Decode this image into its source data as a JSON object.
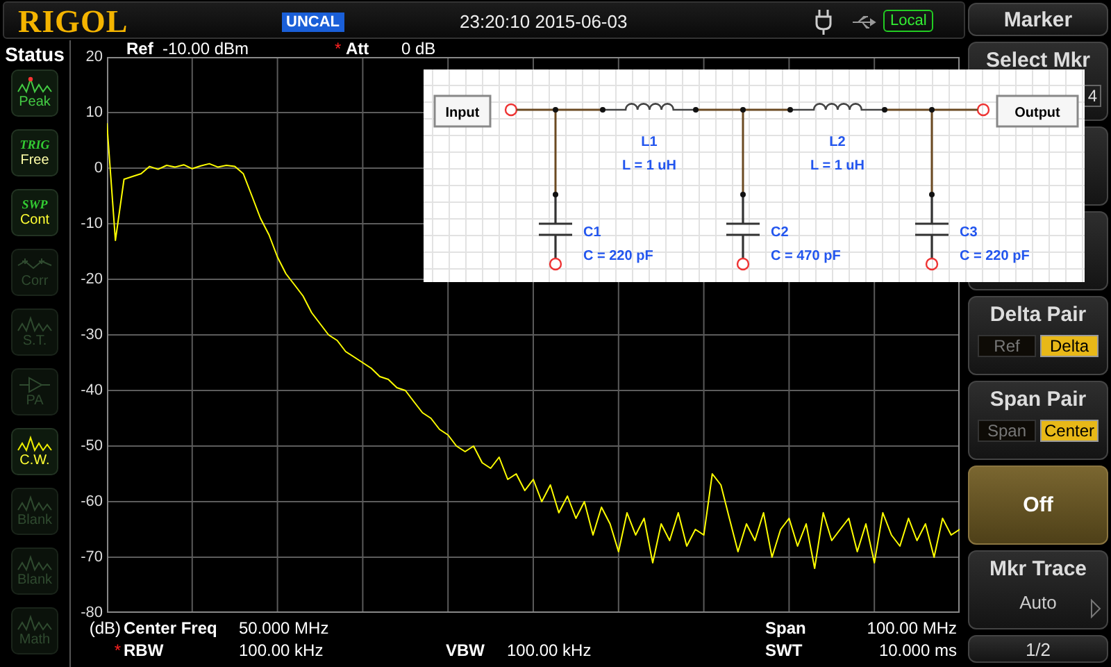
{
  "header": {
    "logo": "RIGOL",
    "mode_badge": "UNCAL",
    "datetime": "23:20:10 2015-06-03",
    "remote_badge": "Local"
  },
  "sidebar": {
    "title": "Status",
    "items": [
      {
        "kind": "peak",
        "caption": "Peak",
        "enabled": true
      },
      {
        "kind": "trig",
        "tag": "TRIG",
        "caption": "Free",
        "enabled": true
      },
      {
        "kind": "swp",
        "tag": "SWP",
        "caption": "Cont",
        "enabled": true
      },
      {
        "kind": "corr",
        "caption": "Corr",
        "enabled": false
      },
      {
        "kind": "st",
        "caption": "S.T.",
        "enabled": false
      },
      {
        "kind": "pa",
        "caption": "PA",
        "enabled": false
      },
      {
        "kind": "cw",
        "caption": "C.W.",
        "enabled": true
      },
      {
        "kind": "blank",
        "caption": "Blank",
        "enabled": false
      },
      {
        "kind": "blank",
        "caption": "Blank",
        "enabled": false
      },
      {
        "kind": "math",
        "caption": "Math",
        "enabled": false
      }
    ]
  },
  "plot": {
    "ref_label": "Ref",
    "ref_value": "-10.00 dBm",
    "att_mark": "*",
    "att_label": "Att",
    "att_value": "0 dB",
    "chart_data": {
      "type": "line",
      "grid": true,
      "ylim": [
        -80,
        20
      ],
      "yticks": [
        20,
        10,
        0,
        -10,
        -20,
        -30,
        -40,
        -50,
        -60,
        -70,
        -80
      ],
      "categories": [
        null,
        null,
        null,
        null,
        null,
        null,
        null,
        null,
        null,
        null,
        null,
        null,
        null,
        null,
        null,
        null,
        null,
        null,
        null,
        null,
        null,
        null,
        null,
        null,
        null,
        null,
        null,
        null,
        null,
        null,
        null,
        null,
        null,
        null,
        null,
        null,
        null,
        null,
        null,
        null,
        null,
        null,
        null,
        null,
        null,
        null,
        null,
        null,
        null,
        null,
        null,
        null,
        null,
        null,
        null,
        null,
        null,
        null,
        null,
        null,
        null,
        null,
        null,
        null,
        null,
        null,
        null,
        null,
        null,
        null,
        null,
        null,
        null,
        null,
        null,
        null,
        null,
        null,
        null,
        null,
        null,
        null,
        null,
        null,
        null,
        null,
        null,
        null,
        null,
        null,
        null,
        null,
        null,
        null,
        null,
        null,
        null,
        null,
        null,
        null,
        null
      ],
      "series": [
        {
          "color": "#ffff00",
          "values": [
            8,
            -13,
            -2,
            -1.5,
            -1,
            0.3,
            -0.2,
            0.5,
            0.2,
            0.6,
            -0.1,
            0.4,
            0.8,
            0.2,
            0.5,
            0.3,
            -1,
            -5,
            -9,
            -12,
            -16,
            -19,
            -21,
            -23,
            -26,
            -28,
            -30,
            -31,
            -33,
            -34,
            -35,
            -36,
            -37.5,
            -38,
            -39.5,
            -40,
            -42,
            -44,
            -45,
            -47,
            -48,
            -50,
            -51,
            -50,
            -53,
            -54,
            -52,
            -56,
            -55,
            -58,
            -56,
            -60,
            -57,
            -62,
            -59,
            -63,
            -60,
            -66,
            -61,
            -64,
            -69,
            -62,
            -66,
            -63,
            -71,
            -64,
            -67,
            -62,
            -68,
            -65,
            -66,
            -55,
            -57,
            -63,
            -69,
            -64,
            -67,
            -62,
            -70,
            -65,
            -63,
            -68,
            -64,
            -72,
            -62,
            -67,
            -65,
            -63,
            -69,
            -64,
            -71,
            -62,
            -66,
            -68,
            -63,
            -67,
            -64,
            -70,
            -63,
            -66,
            -65
          ]
        }
      ]
    }
  },
  "footer": {
    "rows": [
      {
        "unit": "(dB)",
        "left": {
          "label": "Center Freq",
          "value": "50.000 MHz"
        },
        "right": {
          "label": "Span",
          "value": "100.00 MHz"
        }
      },
      {
        "left": {
          "mark": "*",
          "label": "RBW",
          "value": "100.00 kHz"
        },
        "middle": {
          "label": "VBW",
          "value": "100.00 kHz"
        },
        "right": {
          "label": "SWT",
          "value": "10.000 ms"
        }
      }
    ]
  },
  "schematic": {
    "input_label": "Input",
    "output_label": "Output",
    "inductors": [
      {
        "name": "L1",
        "value": "L = 1 uH"
      },
      {
        "name": "L2",
        "value": "L = 1 uH"
      }
    ],
    "capacitors": [
      {
        "name": "C1",
        "value": "C = 220 pF"
      },
      {
        "name": "C2",
        "value": "C = 470 pF"
      },
      {
        "name": "C3",
        "value": "C = 220 pF"
      }
    ]
  },
  "softkeys": {
    "title": "Marker",
    "keys": [
      {
        "kind": "select",
        "label": "Select Mkr",
        "value": "4"
      },
      {
        "kind": "blank"
      },
      {
        "kind": "blank"
      },
      {
        "kind": "pair",
        "label": "Delta Pair",
        "options": [
          {
            "label": "Ref",
            "selected": false
          },
          {
            "label": "Delta",
            "selected": true
          }
        ]
      },
      {
        "kind": "pair",
        "label": "Span Pair",
        "options": [
          {
            "label": "Span",
            "selected": false
          },
          {
            "label": "Center",
            "selected": true
          }
        ]
      },
      {
        "kind": "action",
        "label": "Off",
        "highlighted": true
      },
      {
        "kind": "menu",
        "label": "Mkr Trace",
        "value": "Auto"
      }
    ],
    "page": "1/2"
  }
}
